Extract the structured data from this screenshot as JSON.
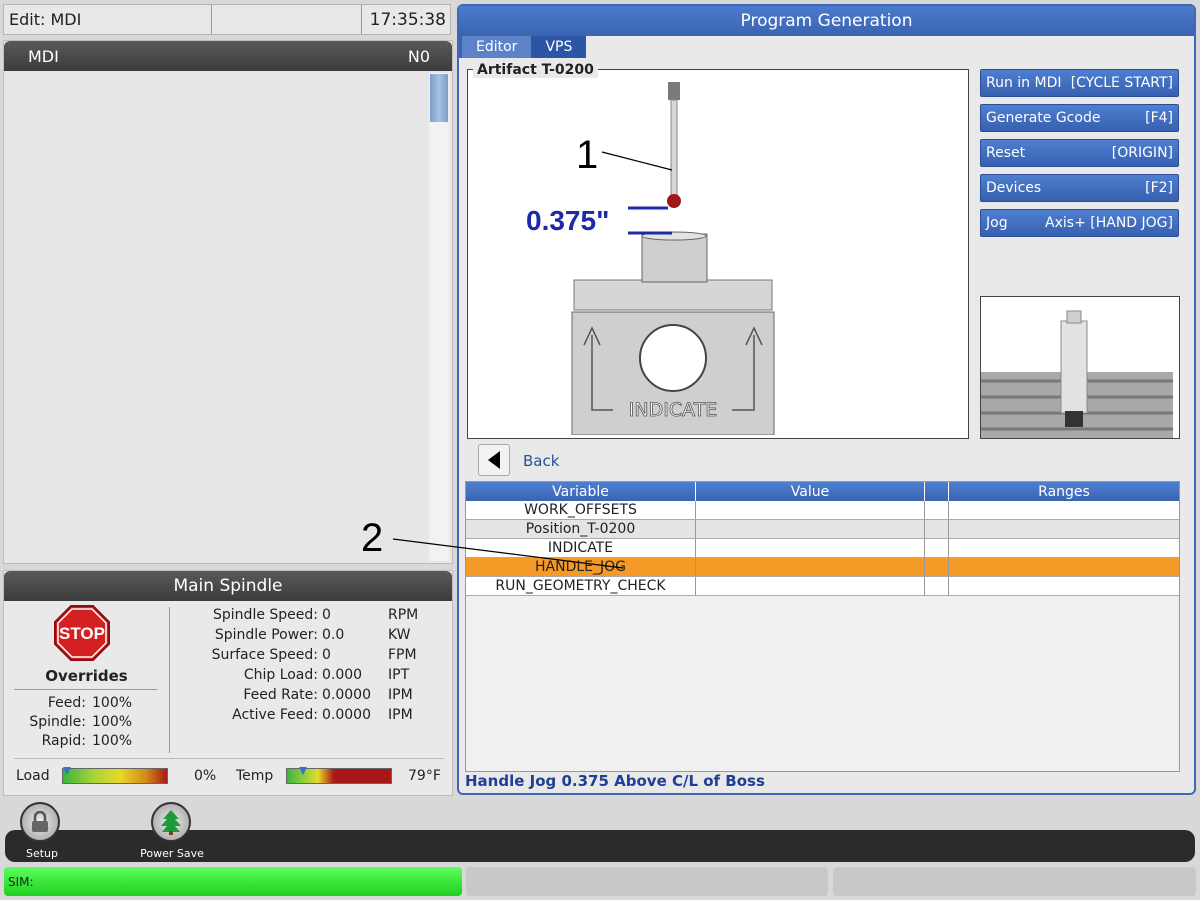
{
  "topbar": {
    "mode": "Edit: MDI",
    "middle": "",
    "time": "17:35:38"
  },
  "mdi": {
    "title": "MDI",
    "line": "N0"
  },
  "spindle": {
    "title": "Main Spindle",
    "stop": "STOP",
    "overrides_title": "Overrides",
    "overrides": [
      {
        "label": "Feed:",
        "value": "100%"
      },
      {
        "label": "Spindle:",
        "value": "100%"
      },
      {
        "label": "Rapid:",
        "value": "100%"
      }
    ],
    "stats": [
      {
        "label": "Spindle Speed:",
        "value": "0",
        "unit": "RPM"
      },
      {
        "label": "Spindle Power:",
        "value": "0.0",
        "unit": "KW"
      },
      {
        "label": "Surface Speed:",
        "value": "0",
        "unit": "FPM"
      },
      {
        "label": "Chip Load:",
        "value": "0.000",
        "unit": "IPT"
      },
      {
        "label": "Feed Rate:",
        "value": "0.0000",
        "unit": "IPM"
      },
      {
        "label": "Active Feed:",
        "value": "0.0000",
        "unit": "IPM"
      }
    ],
    "load_label": "Load",
    "load_value": "0%",
    "load_level": 0,
    "temp_label": "Temp",
    "temp_value": "79°F",
    "temp_level": 0.12
  },
  "pg": {
    "title": "Program Generation",
    "tabs": [
      "Editor",
      "VPS"
    ],
    "artifact_label": "Artifact T-0200",
    "callout1": "1",
    "callout2": "2",
    "dimension": "0.375\"",
    "indicate_text": "INDICATE",
    "buttons": [
      {
        "left": "Run in MDI",
        "right": "[CYCLE START]"
      },
      {
        "left": "Generate Gcode",
        "right": "[F4]"
      },
      {
        "left": "Reset",
        "right": "[ORIGIN]"
      },
      {
        "left": "Devices",
        "right": "[F2]"
      },
      {
        "left": "Jog",
        "right": "Axis+ [HAND JOG]"
      }
    ],
    "back_label": "Back",
    "table_headers": [
      "Variable",
      "Value",
      "",
      "Ranges"
    ],
    "table_rows": [
      "WORK_OFFSETS",
      "Position_T-0200",
      "INDICATE",
      "HANDLE_JOG",
      "RUN_GEOMETRY_CHECK"
    ],
    "status": "Handle Jog 0.375 Above C/L of Boss"
  },
  "toolbar": {
    "setup": "Setup",
    "power_save": "Power Save"
  },
  "sim": {
    "label": "SIM:"
  },
  "colors": {
    "accent": "#3a64b2",
    "selected_row": "#f59a26",
    "sim_green": "#2ee82e",
    "stop_red": "#d42020"
  }
}
